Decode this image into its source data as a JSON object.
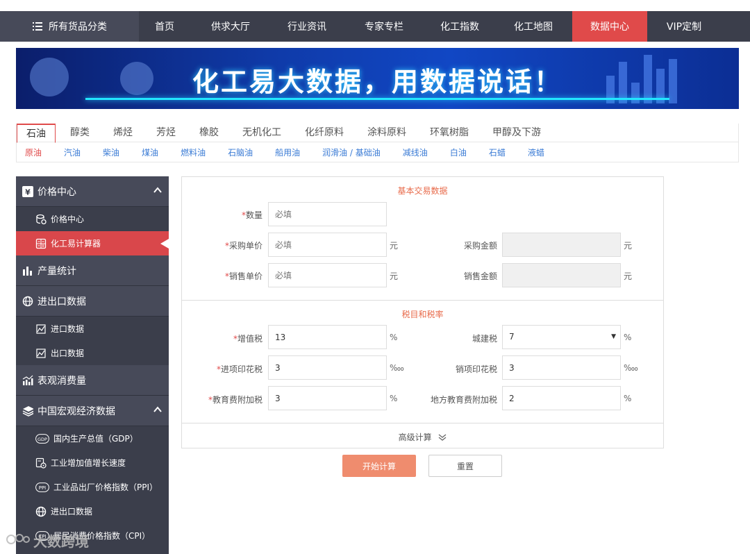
{
  "topnav": {
    "category_label": "所有货品分类",
    "items": [
      "首页",
      "供求大厅",
      "行业资讯",
      "专家专栏",
      "化工指数",
      "化工地图",
      "数据中心",
      "VIP定制"
    ],
    "active_index": 6,
    "active_color": "#e04a4a"
  },
  "banner": {
    "text": "化工易大数据，用数据说话！"
  },
  "tabs": {
    "primary": [
      "石油",
      "醇类",
      "烯烃",
      "芳烃",
      "橡胶",
      "无机化工",
      "化纤原料",
      "涂料原料",
      "环氧树脂",
      "甲醇及下游"
    ],
    "primary_active": 0,
    "secondary": [
      "原油",
      "汽油",
      "柴油",
      "煤油",
      "燃料油",
      "石脑油",
      "船用油",
      "润滑油 / 基础油",
      "减线油",
      "白油",
      "石蜡",
      "液蜡"
    ],
    "secondary_active": 0
  },
  "sidebar": {
    "price_center": {
      "label": "价格中心",
      "icon": "yen-icon"
    },
    "price_center_sub": "价格中心",
    "calculator": "化工易计算器",
    "production": "产量统计",
    "import_export": "进出口数据",
    "import": "进口数据",
    "export": "出口数据",
    "apparent": "表观消费量",
    "macro": "中国宏观经济数据",
    "gdp": "国内生产总值（GDP）",
    "industry_growth": "工业增加值增长速度",
    "ppi": "工业品出厂价格指数（PPI）",
    "macro_ie": "进出口数据",
    "cpi": "居民消费价格指数（CPI）",
    "gdp_badge": "GDP",
    "ppi_badge": "PPI",
    "cpi_badge": "CPI"
  },
  "form": {
    "section1_title": "基本交易数据",
    "quantity_label": "数量",
    "quantity_placeholder": "必填",
    "purchase_price_label": "采购单价",
    "purchase_price_placeholder": "必填",
    "purchase_amount_label": "采购金额",
    "sale_price_label": "销售单价",
    "sale_price_placeholder": "必填",
    "sale_amount_label": "销售金额",
    "currency_unit": "元",
    "section2_title": "税目和税率",
    "vat_label": "增值税",
    "vat_value": "13",
    "city_tax_label": "城建税",
    "city_tax_value": "7",
    "input_stamp_label": "进项印花税",
    "input_stamp_value": "3",
    "output_stamp_label": "销项印花税",
    "output_stamp_value": "3",
    "edu_label": "教育费附加税",
    "edu_value": "3",
    "local_edu_label": "地方教育费附加税",
    "local_edu_value": "2",
    "percent": "%",
    "permyriad": "‱",
    "required_mark": "*",
    "advanced_label": "高级计算",
    "start_button": "开始计算",
    "reset_button": "重置",
    "accent_color": "#ef8c6e"
  },
  "watermark": {
    "text": "大数跨境"
  }
}
